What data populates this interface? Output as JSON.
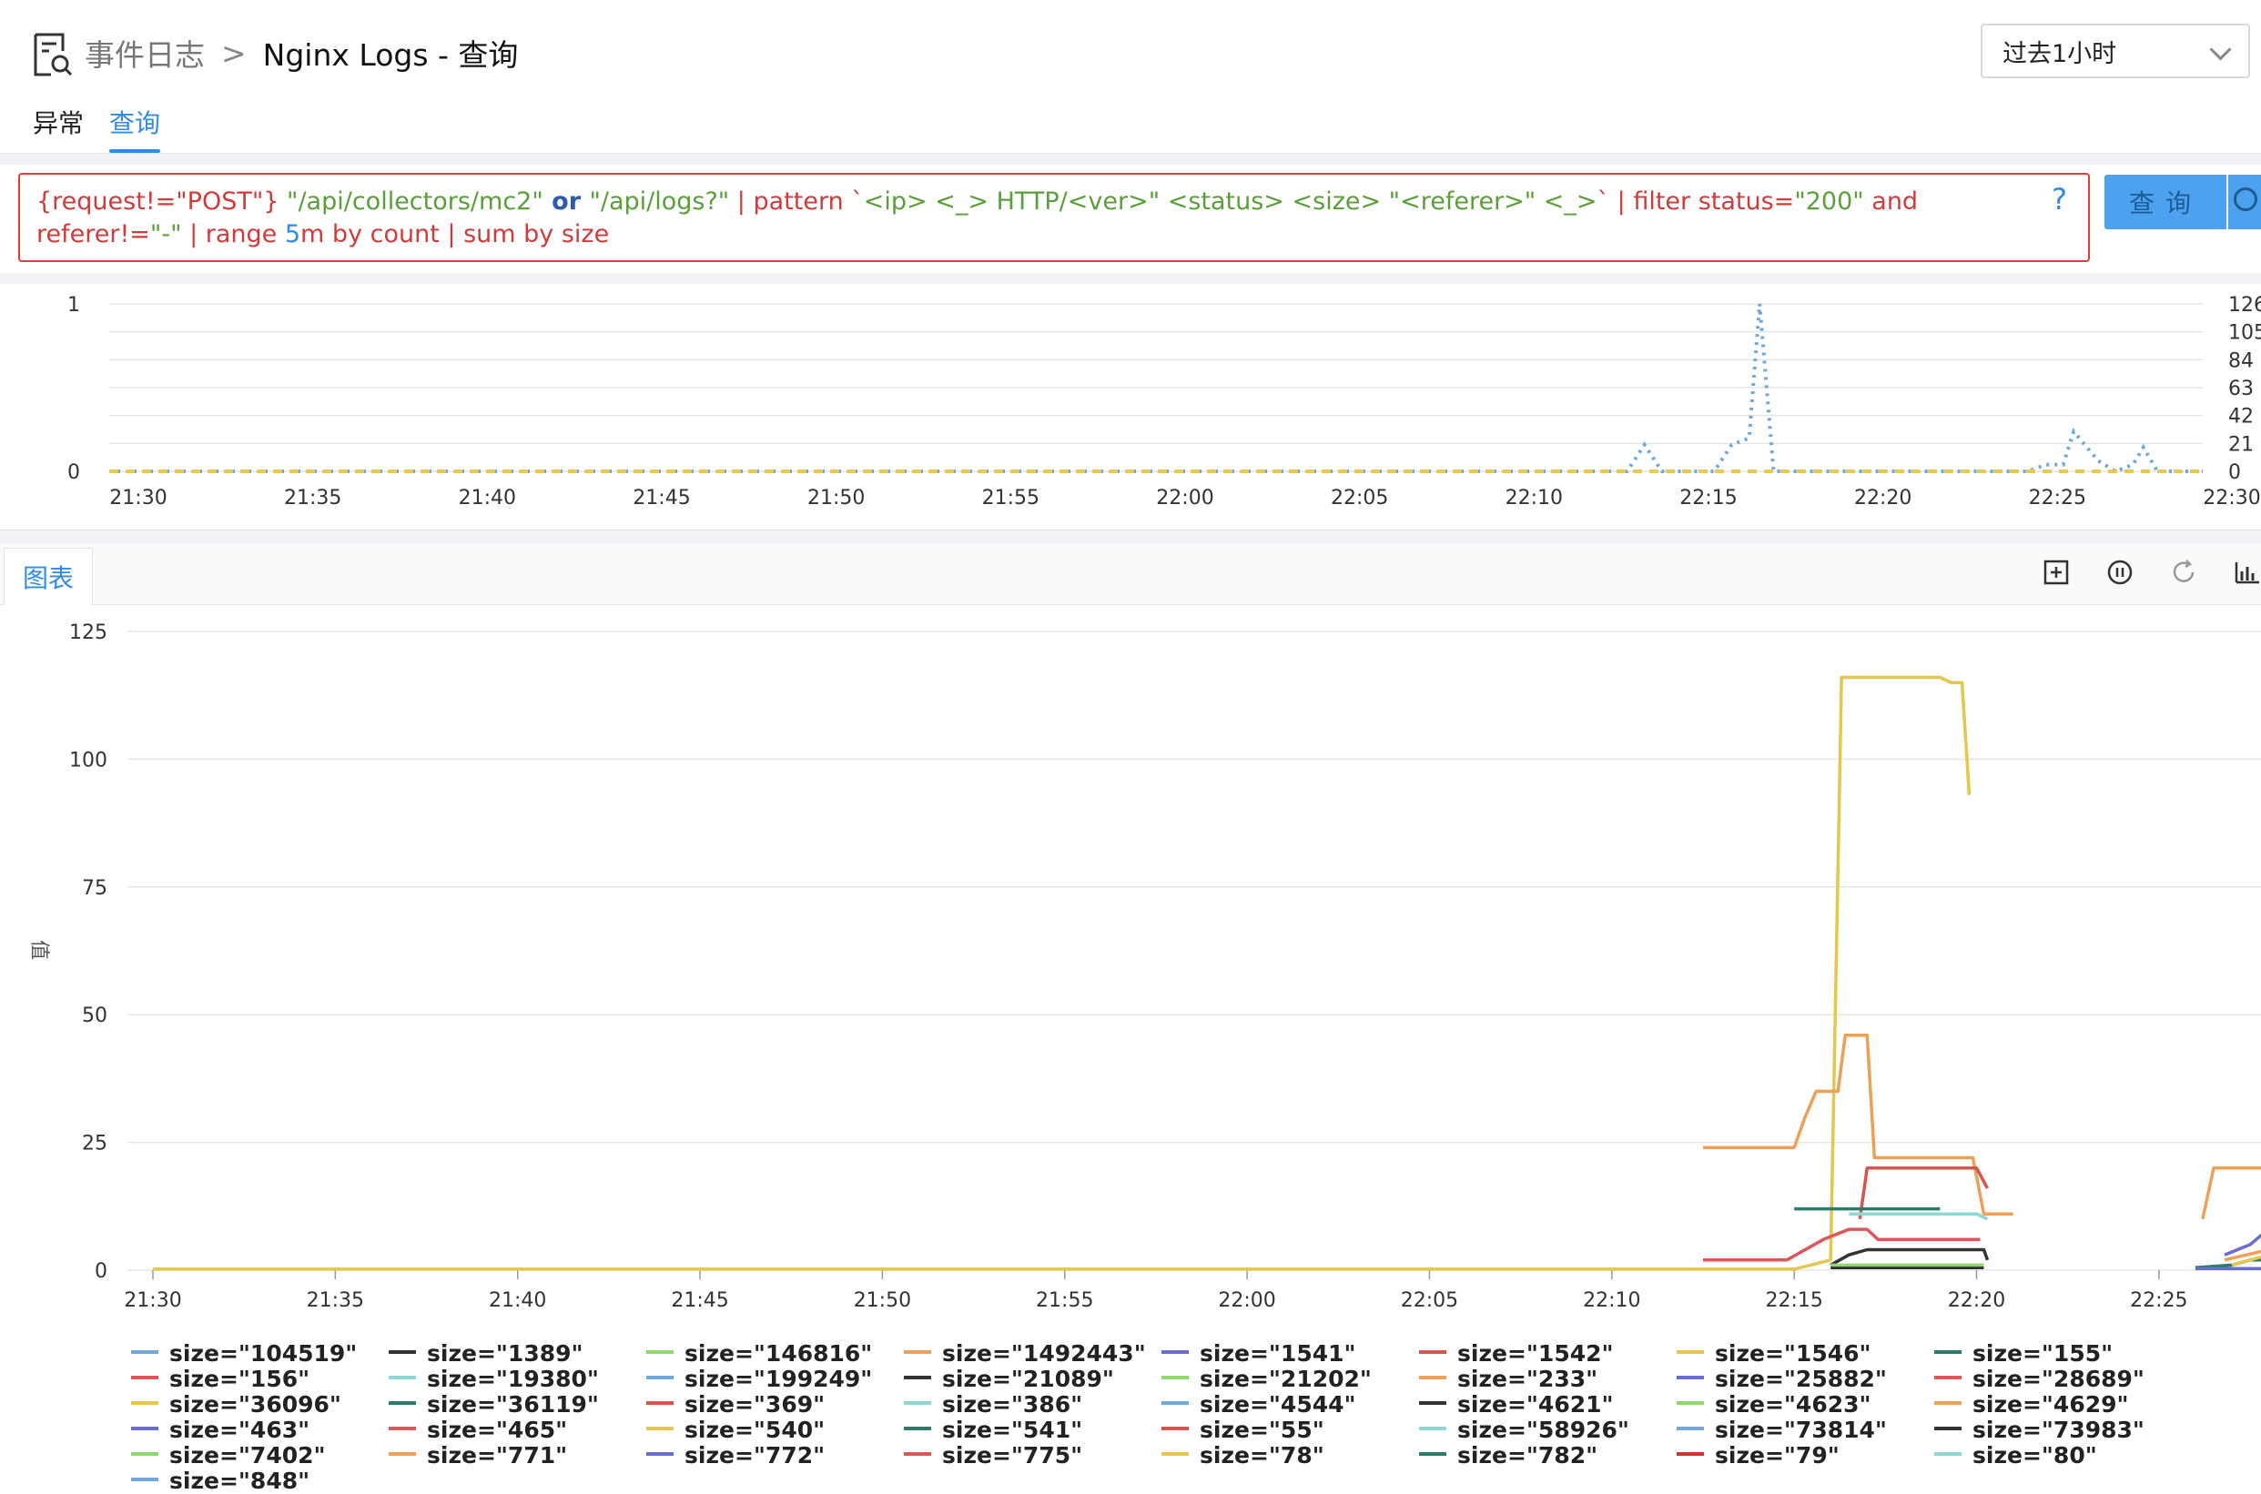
{
  "header": {
    "breadcrumb_parent": "事件日志",
    "breadcrumb_sep": ">",
    "breadcrumb_current": "Nginx Logs - 查询",
    "tabs": [
      {
        "label": "异常",
        "active": false
      },
      {
        "label": "查询",
        "active": true
      }
    ],
    "time_range": "过去1小时"
  },
  "query": {
    "help": "?",
    "button": "查询",
    "parts": [
      {
        "t": "{request!=\"POST\"} ",
        "c": "r"
      },
      {
        "t": "\"/api/collectors/mc2\"",
        "c": "g"
      },
      {
        "t": " or ",
        "c": "b"
      },
      {
        "t": "\"/api/logs?\"",
        "c": "g"
      },
      {
        "t": " | pattern `",
        "c": "r"
      },
      {
        "t": "<ip> <_> HTTP/<ver>\" <status> <size> \"<referer>\" <_>",
        "c": "g"
      },
      {
        "t": "` | filter status=",
        "c": "r"
      },
      {
        "t": "\"200\"",
        "c": "g"
      },
      {
        "t": " and referer!=",
        "c": "r"
      },
      {
        "t": "\"-\"",
        "c": "g"
      },
      {
        "t": " | ",
        "c": "r"
      },
      {
        "t": "range ",
        "c": "r"
      },
      {
        "t": "5",
        "c": "n"
      },
      {
        "t": "m by count | sum by size",
        "c": "r"
      }
    ]
  },
  "chart_tab": "图表",
  "toolbar_icons": [
    "add-panel-icon",
    "pause-icon",
    "refresh-icon",
    "bar-chart-icon"
  ],
  "chart_data": [
    {
      "type": "line",
      "x": [
        "21:30",
        "21:35",
        "21:40",
        "21:45",
        "21:50",
        "21:55",
        "22:00",
        "22:05",
        "22:10",
        "22:15",
        "22:20",
        "22:25",
        "22:30"
      ],
      "yticks_left": [
        "1",
        "0"
      ],
      "yticks_right": [
        "126",
        "105",
        "84",
        "63",
        "42",
        "21",
        "0"
      ],
      "series": [
        {
          "color": "#6fa8dc",
          "style": "dotted",
          "points": [
            [
              0,
              0
            ],
            [
              43.5,
              0
            ],
            [
              44,
              20
            ],
            [
              44.5,
              0
            ],
            [
              46,
              0
            ],
            [
              46.5,
              20
            ],
            [
              47,
              25
            ],
            [
              47.3,
              126
            ],
            [
              47.7,
              0
            ],
            [
              55,
              0
            ],
            [
              55.5,
              5
            ],
            [
              56,
              5
            ],
            [
              56.3,
              30
            ],
            [
              57,
              8
            ],
            [
              57.5,
              0
            ],
            [
              58,
              5
            ],
            [
              58.3,
              18
            ],
            [
              58.7,
              0
            ],
            [
              60,
              0
            ]
          ]
        },
        {
          "color": "#e8c85a",
          "style": "dashed",
          "points": [
            [
              0,
              0
            ],
            [
              60,
              0
            ]
          ]
        }
      ]
    },
    {
      "type": "line",
      "x_ticks": [
        "21:30",
        "21:35",
        "21:40",
        "21:45",
        "21:50",
        "21:55",
        "22:00",
        "22:05",
        "22:10",
        "22:15",
        "22:20",
        "22:25",
        "22:30"
      ],
      "y_ticks": [
        125,
        100,
        75,
        50,
        25,
        0
      ],
      "ylim": [
        0,
        125
      ],
      "ylabel": "值",
      "series": [
        {
          "name": "size=\"1546\"",
          "color": "#e5c74c",
          "points": [
            [
              0,
              0.2
            ],
            [
              45,
              0.2
            ],
            [
              46,
              2
            ],
            [
              46.3,
              116
            ],
            [
              49,
              116
            ],
            [
              49.3,
              115
            ],
            [
              49.6,
              115
            ],
            [
              49.8,
              93
            ]
          ]
        },
        {
          "name": "size=\"4629\"",
          "color": "#eda158",
          "points": [
            [
              42.5,
              24
            ],
            [
              45,
              24
            ],
            [
              45.3,
              30
            ],
            [
              45.6,
              35
            ],
            [
              46.2,
              35
            ],
            [
              46.4,
              46
            ],
            [
              47,
              46
            ],
            [
              47.2,
              22
            ],
            [
              49.9,
              22
            ],
            [
              50.2,
              11
            ],
            [
              51,
              11
            ]
          ]
        },
        {
          "name": "size=\"4629\"",
          "color": "#eda158",
          "points": [
            [
              56.2,
              10
            ],
            [
              56.5,
              20
            ],
            [
              58.3,
              20
            ],
            [
              58.6,
              30
            ],
            [
              61,
              30
            ]
          ]
        },
        {
          "name": "size=\"1542\"",
          "color": "#d9534f",
          "points": [
            [
              46.8,
              10
            ],
            [
              47,
              20
            ],
            [
              50,
              20
            ],
            [
              50.3,
              16
            ]
          ]
        },
        {
          "name": "size=\"155\"",
          "color": "#2b7b6b",
          "points": [
            [
              45,
              12
            ],
            [
              49,
              12
            ]
          ]
        },
        {
          "name": "size=\"58926\"",
          "color": "#8fd8d2",
          "points": [
            [
              46.5,
              11
            ],
            [
              50,
              11
            ],
            [
              50.3,
              10
            ]
          ]
        },
        {
          "name": "size=\"156\"",
          "color": "#e0555a",
          "points": [
            [
              42.5,
              2
            ],
            [
              44.8,
              2
            ],
            [
              45.3,
              4
            ],
            [
              45.8,
              6
            ],
            [
              46.5,
              8
            ],
            [
              47,
              8
            ],
            [
              47.3,
              6
            ],
            [
              50.1,
              6
            ]
          ]
        },
        {
          "name": "size=\"79\"",
          "color": "#cc3333",
          "points": [
            [
              58,
              9
            ],
            [
              58.3,
              10
            ],
            [
              58.8,
              11
            ],
            [
              60,
              11
            ],
            [
              61,
              10
            ]
          ]
        },
        {
          "name": "size=\"1541\"",
          "color": "#6b6bd6",
          "points": [
            [
              56.8,
              3
            ],
            [
              57.5,
              5
            ],
            [
              58,
              8
            ],
            [
              61,
              8
            ]
          ]
        },
        {
          "name": "size=\"771\"",
          "color": "#eda158",
          "points": [
            [
              56.8,
              2
            ],
            [
              58,
              4
            ],
            [
              58.5,
              6
            ],
            [
              61,
              6
            ]
          ]
        },
        {
          "name": "size=\"73983\"",
          "color": "#333333",
          "points": [
            [
              46,
              1
            ],
            [
              46.5,
              3
            ],
            [
              47,
              4
            ],
            [
              50.2,
              4
            ],
            [
              50.3,
              2
            ]
          ]
        },
        {
          "name": "size=\"1389\"",
          "color": "#333333",
          "points": [
            [
              46,
              0.5
            ],
            [
              50.2,
              0.5
            ]
          ]
        },
        {
          "name": "size=\"541\"",
          "color": "#2b7b6b",
          "points": [
            [
              56,
              0.5
            ],
            [
              57,
              1
            ],
            [
              57.5,
              2
            ],
            [
              61,
              2
            ]
          ]
        },
        {
          "name": "size=\"463\"",
          "color": "#6b6bd6",
          "points": [
            [
              56,
              0.3
            ],
            [
              61,
              0.3
            ]
          ]
        },
        {
          "name": "size=\"146816\"",
          "color": "#8fd870",
          "points": [
            [
              46,
              1
            ],
            [
              50.2,
              1
            ]
          ]
        },
        {
          "name": "size=\"36096\"",
          "color": "#e5c74c",
          "points": [
            [
              57,
              1
            ],
            [
              58,
              3
            ],
            [
              61,
              3
            ]
          ]
        }
      ]
    }
  ],
  "legend": [
    [
      "size=\"104519\"",
      "#6fa8dc"
    ],
    [
      "size=\"1389\"",
      "#333333"
    ],
    [
      "size=\"146816\"",
      "#8fd870"
    ],
    [
      "size=\"1492443\"",
      "#eda158"
    ],
    [
      "size=\"1541\"",
      "#6b6bd6"
    ],
    [
      "size=\"1542\"",
      "#d9534f"
    ],
    [
      "size=\"1546\"",
      "#e5c74c"
    ],
    [
      "size=\"155\"",
      "#2b7b6b"
    ],
    [
      "size=\"156\"",
      "#e0555a"
    ],
    [
      "size=\"19380\"",
      "#8fd8d2"
    ],
    [
      "size=\"199249\"",
      "#6fa8dc"
    ],
    [
      "size=\"21089\"",
      "#333333"
    ],
    [
      "size=\"21202\"",
      "#8fd870"
    ],
    [
      "size=\"233\"",
      "#eda158"
    ],
    [
      "size=\"25882\"",
      "#6b6bd6"
    ],
    [
      "size=\"28689\"",
      "#e0555a"
    ],
    [
      "size=\"36096\"",
      "#e5c74c"
    ],
    [
      "size=\"36119\"",
      "#2b7b6b"
    ],
    [
      "size=\"369\"",
      "#d9534f"
    ],
    [
      "size=\"386\"",
      "#8fd8d2"
    ],
    [
      "size=\"4544\"",
      "#6fa8dc"
    ],
    [
      "size=\"4621\"",
      "#333333"
    ],
    [
      "size=\"4623\"",
      "#8fd870"
    ],
    [
      "size=\"4629\"",
      "#eda158"
    ],
    [
      "size=\"463\"",
      "#6b6bd6"
    ],
    [
      "size=\"465\"",
      "#e0555a"
    ],
    [
      "size=\"540\"",
      "#e5c74c"
    ],
    [
      "size=\"541\"",
      "#2b7b6b"
    ],
    [
      "size=\"55\"",
      "#d9534f"
    ],
    [
      "size=\"58926\"",
      "#8fd8d2"
    ],
    [
      "size=\"73814\"",
      "#6fa8dc"
    ],
    [
      "size=\"73983\"",
      "#333333"
    ],
    [
      "size=\"7402\"",
      "#8fd870"
    ],
    [
      "size=\"771\"",
      "#eda158"
    ],
    [
      "size=\"772\"",
      "#6b6bd6"
    ],
    [
      "size=\"775\"",
      "#e0555a"
    ],
    [
      "size=\"78\"",
      "#e5c74c"
    ],
    [
      "size=\"782\"",
      "#2b7b6b"
    ],
    [
      "size=\"79\"",
      "#cc3333"
    ],
    [
      "size=\"80\"",
      "#8fd8d2"
    ],
    [
      "size=\"848\"",
      "#6fa8dc"
    ]
  ]
}
